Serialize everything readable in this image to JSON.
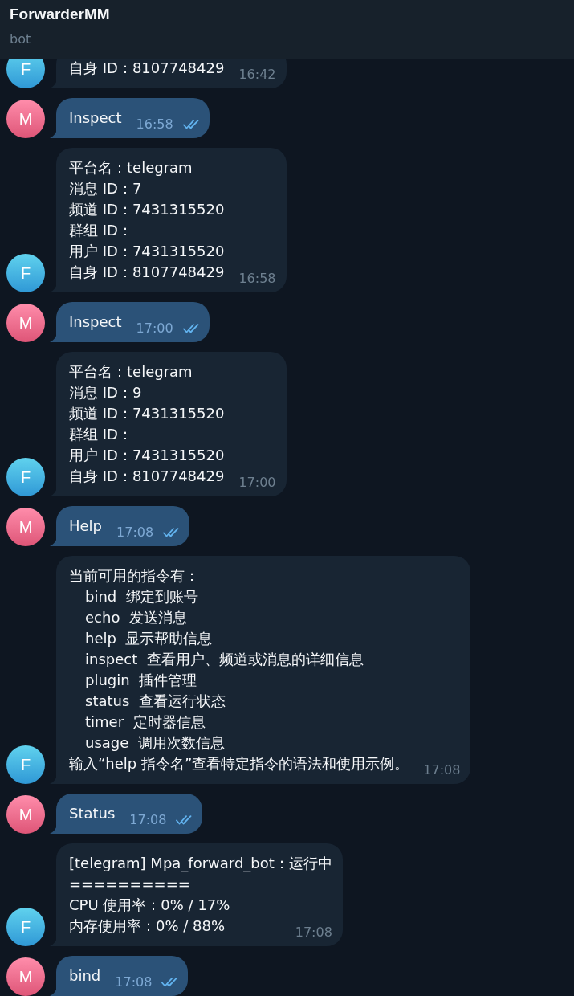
{
  "header": {
    "title": "ForwarderMM",
    "subtitle": "bot"
  },
  "messages": [
    {
      "kind": "incoming",
      "avatar": "F",
      "lines": [
        {
          "text": "自身 ID：8107748429"
        }
      ],
      "time": "16:42"
    },
    {
      "kind": "outgoing",
      "avatar": "M",
      "lines": [
        {
          "text": "Inspect"
        }
      ],
      "time": "16:58",
      "read": true
    },
    {
      "kind": "incoming",
      "avatar": "F",
      "lines": [
        {
          "text": "平台名：telegram"
        },
        {
          "text": "消息 ID：7"
        },
        {
          "text": "频道 ID：7431315520"
        },
        {
          "text": "群组 ID："
        },
        {
          "text": "用户 ID：7431315520"
        },
        {
          "text": "自身 ID：8107748429"
        }
      ],
      "time": "16:58"
    },
    {
      "kind": "outgoing",
      "avatar": "M",
      "lines": [
        {
          "text": "Inspect"
        }
      ],
      "time": "17:00",
      "read": true
    },
    {
      "kind": "incoming",
      "avatar": "F",
      "lines": [
        {
          "text": "平台名：telegram"
        },
        {
          "text": "消息 ID：9"
        },
        {
          "text": "频道 ID：7431315520"
        },
        {
          "text": "群组 ID："
        },
        {
          "text": "用户 ID：7431315520"
        },
        {
          "text": "自身 ID：8107748429"
        }
      ],
      "time": "17:00"
    },
    {
      "kind": "outgoing",
      "avatar": "M",
      "lines": [
        {
          "text": "Help"
        }
      ],
      "time": "17:08",
      "read": true
    },
    {
      "kind": "incoming",
      "avatar": "F",
      "lines": [
        {
          "text": "当前可用的指令有：",
          "children": [
            {
              "text": "bind  绑定到账号"
            },
            {
              "text": "echo  发送消息"
            },
            {
              "text": "help  显示帮助信息"
            },
            {
              "text": "inspect  查看用户、频道或消息的详细信息"
            },
            {
              "text": "plugin  插件管理"
            },
            {
              "text": "status  查看运行状态"
            },
            {
              "text": "timer  定时器信息"
            },
            {
              "text": "usage  调用次数信息"
            }
          ]
        },
        {
          "text": "输入“help 指令名”查看特定指令的语法和使用示例。"
        }
      ],
      "time": "17:08"
    },
    {
      "kind": "outgoing",
      "avatar": "M",
      "lines": [
        {
          "text": "Status"
        }
      ],
      "time": "17:08",
      "read": true
    },
    {
      "kind": "incoming",
      "avatar": "F",
      "lines": [
        {
          "text": "[telegram] Mpa_forward_bot：运行中"
        },
        {
          "text": "=========="
        },
        {
          "text": "CPU 使用率：0% / 17%"
        },
        {
          "text": "内存使用率：0% / 88%"
        }
      ],
      "time": "17:08"
    },
    {
      "kind": "outgoing",
      "avatar": "M",
      "lines": [
        {
          "text": "bind"
        }
      ],
      "time": "17:08",
      "read": true
    }
  ]
}
